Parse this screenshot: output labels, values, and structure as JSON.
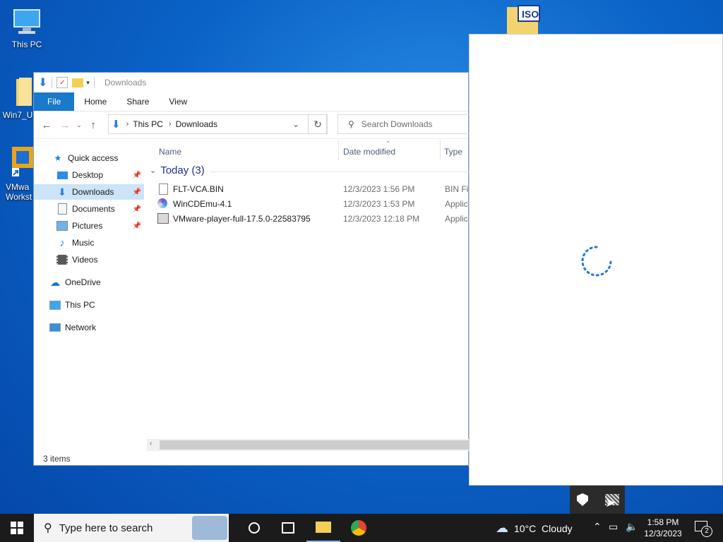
{
  "desktop": {
    "icons": [
      {
        "label": "This PC"
      },
      {
        "label": "Win7_U"
      },
      {
        "label": "VMwa\nWorkst"
      },
      {
        "label": "ISO"
      }
    ]
  },
  "explorer": {
    "title": "Downloads",
    "ribbon_tabs": [
      "File",
      "Home",
      "Share",
      "View"
    ],
    "breadcrumb": [
      "This PC",
      "Downloads"
    ],
    "search_placeholder": "Search Downloads",
    "nav": [
      {
        "label": "Quick access",
        "icon": "star-icon"
      },
      {
        "label": "Desktop",
        "icon": "desktop-icon",
        "pinned": true
      },
      {
        "label": "Downloads",
        "icon": "download-icon",
        "pinned": true,
        "selected": true
      },
      {
        "label": "Documents",
        "icon": "documents-icon",
        "pinned": true
      },
      {
        "label": "Pictures",
        "icon": "pictures-icon",
        "pinned": true
      },
      {
        "label": "Music",
        "icon": "music-icon"
      },
      {
        "label": "Videos",
        "icon": "videos-icon"
      },
      {
        "label": "OneDrive",
        "icon": "cloud-icon"
      },
      {
        "label": "This PC",
        "icon": "computer-icon"
      },
      {
        "label": "Network",
        "icon": "network-icon"
      }
    ],
    "columns": {
      "name": "Name",
      "date": "Date modified",
      "type": "Type"
    },
    "group": "Today (3)",
    "files": [
      {
        "name": "FLT-VCA.BIN",
        "date": "12/3/2023 1:56 PM",
        "type": "BIN Fil",
        "icon": "file-icon"
      },
      {
        "name": "WinCDEmu-4.1",
        "date": "12/3/2023 1:53 PM",
        "type": "Applic",
        "icon": "disc-app-icon"
      },
      {
        "name": "VMware-player-full-17.5.0-22583795",
        "date": "12/3/2023 12:18 PM",
        "type": "Applic",
        "icon": "installer-icon"
      }
    ],
    "status": "3 items"
  },
  "taskbar": {
    "search_placeholder": "Type here to search",
    "weather": "10°C  Cloudy",
    "time": "1:58 PM",
    "date": "12/3/2023",
    "notifications": "2"
  },
  "colors": {
    "accent": "#1979ca",
    "selection": "#cce4f7",
    "taskbar": "#1b1b1b"
  }
}
